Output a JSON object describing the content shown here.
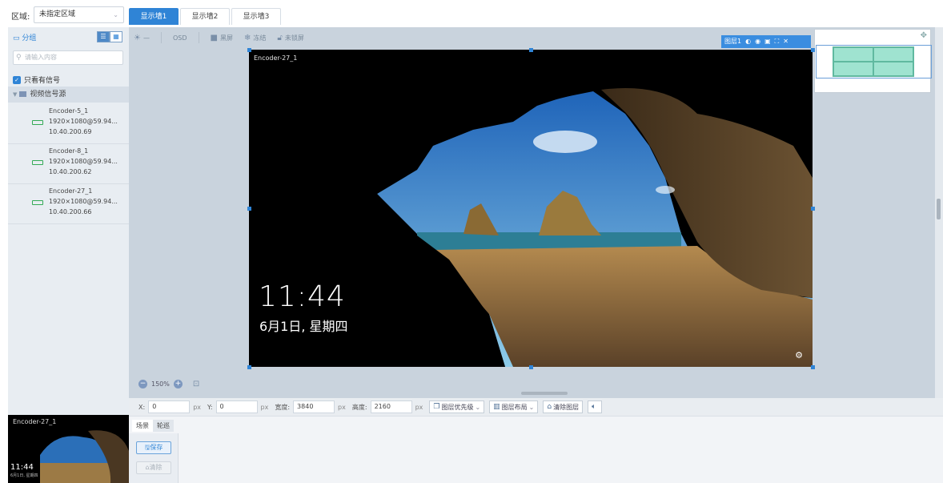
{
  "region": {
    "label": "区域:",
    "value": "未指定区域"
  },
  "tabs": [
    {
      "label": "显示墙1",
      "active": true
    },
    {
      "label": "显示墙2",
      "active": false
    },
    {
      "label": "显示墙3",
      "active": false
    }
  ],
  "left_panel": {
    "group_label": "分组",
    "search_placeholder": "请输入内容",
    "only_signal_label": "只看有信号",
    "tree_head": "视频信号源",
    "encoders": [
      {
        "name": "Encoder-5_1",
        "res": "1920×1080@59.94...",
        "ip": "10.40.200.69"
      },
      {
        "name": "Encoder-8_1",
        "res": "1920×1080@59.94...",
        "ip": "10.40.200.62"
      },
      {
        "name": "Encoder-27_1",
        "res": "1920×1080@59.94...",
        "ip": "10.40.200.66"
      }
    ]
  },
  "toolbar": {
    "osd": "OSD",
    "black_screen": "黑屏",
    "freeze": "冻结",
    "unlock": "未锁屏"
  },
  "video": {
    "title": "Encoder-27_1",
    "time": "11:44",
    "date": "6月1日, 星期四",
    "layer_label": "图层1"
  },
  "zoom": {
    "level": "150%"
  },
  "props": {
    "x_label": "X:",
    "x_value": "0",
    "y_label": "Y:",
    "y_value": "0",
    "unit": "px",
    "width_label": "宽度:",
    "width_value": "3840",
    "height_label": "高度:",
    "height_value": "2160",
    "priority_btn": "图层优先级",
    "layout_btn": "图层布局",
    "clear_btn": "清除图层"
  },
  "thumb": {
    "title": "Encoder-27_1",
    "time": "11:44",
    "date": "6月1日, 星期四"
  },
  "scene": {
    "tab_scene": "场景",
    "tab_patrol": "轮巡",
    "save": "保存",
    "delete": "清除"
  },
  "colors": {
    "accent": "#2f84d6",
    "canvas_bg": "#c9d3dd",
    "minimap_cell": "#9fe3d0"
  }
}
